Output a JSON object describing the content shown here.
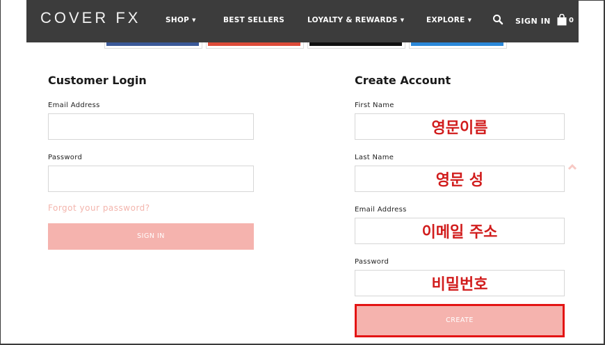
{
  "header": {
    "logo": "COVER FX",
    "nav": [
      {
        "label": "SHOP",
        "dropdown": true
      },
      {
        "label": "BEST SELLERS",
        "dropdown": false
      },
      {
        "label": "LOYALTY & REWARDS",
        "dropdown": true
      },
      {
        "label": "EXPLORE",
        "dropdown": true
      }
    ],
    "caret": "▼",
    "sign_in": "SIGN IN",
    "cart_count": "0"
  },
  "social_colors": [
    "#3b5998",
    "#dd4b39",
    "#111111",
    "#2b88d9"
  ],
  "login": {
    "title": "Customer Login",
    "email_label": "Email Address",
    "password_label": "Password",
    "forgot": "Forgot your password?",
    "sign_in_button": "SIGN IN"
  },
  "create": {
    "title": "Create Account",
    "first_name_label": "First Name",
    "first_name_annotation": "영문이름",
    "last_name_label": "Last Name",
    "last_name_annotation": "영문 성",
    "email_label": "Email Address",
    "email_annotation": "이메일 주소",
    "password_label": "Password",
    "password_annotation": "비밀번호",
    "create_button": "CREATE"
  },
  "colors": {
    "topbar": "#3c3c3c",
    "button": "#f5b3ae",
    "annotation": "#d11c1c",
    "highlight": "#e31414"
  }
}
